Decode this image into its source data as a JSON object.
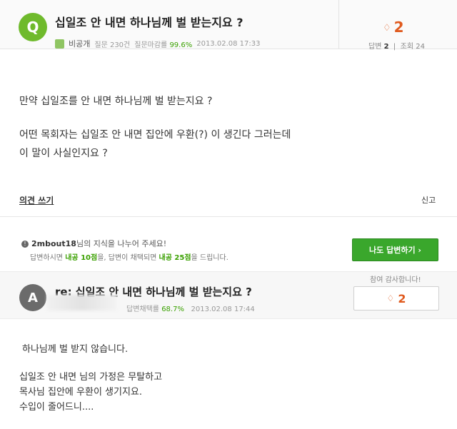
{
  "question": {
    "badge": "Q",
    "title": "십일조 안 내면 하나님께 벌 받는지요 ?",
    "privacy": "비공개",
    "questions_count": "질문 230건",
    "closing_rate_label": "질문마감률",
    "closing_rate": "99.6%",
    "datetime": "2013.02.08 17:33",
    "likes": "2",
    "answers_label": "답변",
    "answers_count": "2",
    "views_label": "조회",
    "views_count": "24",
    "body_lines": [
      "만약 십일조를 안 내면 하나님께 벌 받는지요 ?",
      "어떤 목회자는 십일조 안 내면 집안에 우환(?) 이 생긴다 그러는데",
      "이 말이 사실인지요 ?"
    ],
    "opinion_link": "의견 쓰기",
    "report_link": "신고"
  },
  "share": {
    "username": "2mbout18",
    "line1_suffix": "님의 지식을 나누어 주세요!",
    "line2_a": "답변하시면 ",
    "line2_pts1": "내공 10점",
    "line2_b": "을, 답변이 채택되면 ",
    "line2_pts2": "내공 25점",
    "line2_c": "을 드립니다.",
    "answer_button": "나도 답변하기 ›"
  },
  "answer": {
    "badge": "A",
    "thanks_label": "참여 감사합니다!",
    "title": "re: 십일조 안 내면 하나님께 벌 받는지요 ?",
    "adoption_label": "답변채택률",
    "adoption_rate": "68.7%",
    "datetime": "2013.02.08 17:44",
    "likes": "2",
    "body_line1": "하나님께 벌 받지 않습니다.",
    "body_lines": [
      "십일조  안 내면 님의 가정은 무탈하고",
      "목사님 집안에 우환이 생기지요.",
      "수입이 줄어드니...."
    ]
  }
}
